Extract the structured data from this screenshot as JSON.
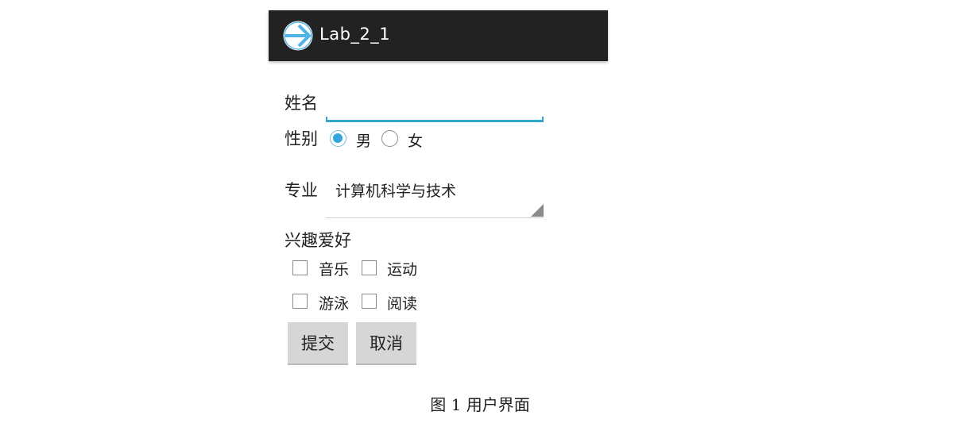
{
  "app": {
    "title": "Lab_2_1",
    "icon": "arrow-right-circle-icon",
    "accent_color": "#33a6cc",
    "bar_color": "#222222"
  },
  "form": {
    "name_label": "姓名",
    "name_value": "",
    "gender_label": "性别",
    "gender_options": [
      {
        "label": "男",
        "checked": true
      },
      {
        "label": "女",
        "checked": false
      }
    ],
    "major_label": "专业",
    "major_value": "计算机科学与技术",
    "hobbies_label": "兴趣爱好",
    "hobbies": [
      {
        "label": "音乐",
        "checked": false
      },
      {
        "label": "运动",
        "checked": false
      },
      {
        "label": "游泳",
        "checked": false
      },
      {
        "label": "阅读",
        "checked": false
      }
    ],
    "submit_label": "提交",
    "cancel_label": "取消"
  },
  "caption": "图 1  用户界面"
}
